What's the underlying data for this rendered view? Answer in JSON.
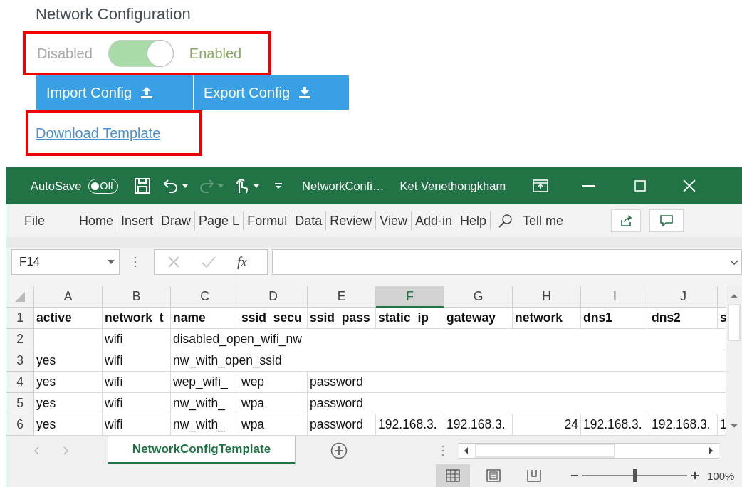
{
  "page": {
    "title": "Network Configuration",
    "toggle": {
      "off_label": "Disabled",
      "on_label": "Enabled",
      "on": true,
      "highlighted": true
    },
    "buttons": [
      {
        "label": "Import Config",
        "kind": "upload"
      },
      {
        "label": "Export Config",
        "kind": "download"
      }
    ],
    "link": {
      "label": "Download Template",
      "highlighted": true
    }
  },
  "excel": {
    "title_bar": {
      "autosave_label": "AutoSave",
      "autosave_state": "Off",
      "autosave_on": false,
      "file_name": "NetworkConfi…",
      "user": "Ket Venethongkham"
    },
    "ribbon_tabs": [
      "File",
      "Home",
      "Insert",
      "Draw",
      "Page L",
      "Formul",
      "Data",
      "Review",
      "View",
      "Add-in",
      "Help"
    ],
    "tell_me": "Tell me",
    "name_box": "F14",
    "fx": "fx",
    "columns": [
      {
        "label": "A",
        "selected": false
      },
      {
        "label": "B",
        "selected": false
      },
      {
        "label": "C",
        "selected": false
      },
      {
        "label": "D",
        "selected": false
      },
      {
        "label": "E",
        "selected": false
      },
      {
        "label": "F",
        "selected": true
      },
      {
        "label": "G",
        "selected": false
      },
      {
        "label": "H",
        "selected": false
      },
      {
        "label": "I",
        "selected": false
      },
      {
        "label": "J",
        "selected": false
      }
    ],
    "rows": [
      {
        "number": "1",
        "kind": "header",
        "cells": [
          {
            "kind": "text",
            "text": "active"
          },
          {
            "kind": "text",
            "text": "network_t"
          },
          {
            "kind": "text",
            "text": "name"
          },
          {
            "kind": "text",
            "text": "ssid_secu"
          },
          {
            "kind": "text",
            "text": "ssid_pass"
          },
          {
            "kind": "text",
            "text": "static_ip"
          },
          {
            "kind": "text",
            "text": "gateway"
          },
          {
            "kind": "text",
            "text": "network_"
          },
          {
            "kind": "text",
            "text": "dns1"
          },
          {
            "kind": "text",
            "text": "dns2"
          },
          {
            "kind": "text",
            "text": "s"
          }
        ]
      },
      {
        "number": "2",
        "kind": "data",
        "cells": [
          {
            "kind": "empty"
          },
          {
            "kind": "text",
            "text": "wifi"
          },
          {
            "kind": "text",
            "text": "disabled_open_wifi_nw"
          },
          {
            "kind": "empty"
          },
          {
            "kind": "empty"
          },
          {
            "kind": "empty"
          },
          {
            "kind": "empty"
          },
          {
            "kind": "empty"
          },
          {
            "kind": "empty"
          },
          {
            "kind": "empty"
          },
          {
            "kind": "empty"
          }
        ]
      },
      {
        "number": "3",
        "kind": "data",
        "cells": [
          {
            "kind": "text",
            "text": "yes"
          },
          {
            "kind": "text",
            "text": "wifi"
          },
          {
            "kind": "text",
            "text": "nw_with_open_ssid"
          },
          {
            "kind": "empty"
          },
          {
            "kind": "empty"
          },
          {
            "kind": "empty"
          },
          {
            "kind": "empty"
          },
          {
            "kind": "empty"
          },
          {
            "kind": "empty"
          },
          {
            "kind": "empty"
          },
          {
            "kind": "empty"
          }
        ]
      },
      {
        "number": "4",
        "kind": "data",
        "cells": [
          {
            "kind": "text",
            "text": "yes"
          },
          {
            "kind": "text",
            "text": "wifi"
          },
          {
            "kind": "text",
            "text": "wep_wifi_"
          },
          {
            "kind": "text",
            "text": "wep"
          },
          {
            "kind": "text",
            "text": "password"
          },
          {
            "kind": "empty"
          },
          {
            "kind": "empty"
          },
          {
            "kind": "empty"
          },
          {
            "kind": "empty"
          },
          {
            "kind": "empty"
          },
          {
            "kind": "empty"
          }
        ]
      },
      {
        "number": "5",
        "kind": "data",
        "cells": [
          {
            "kind": "text",
            "text": "yes"
          },
          {
            "kind": "text",
            "text": "wifi"
          },
          {
            "kind": "text",
            "text": "nw_with_"
          },
          {
            "kind": "text",
            "text": "wpa"
          },
          {
            "kind": "text",
            "text": "password"
          },
          {
            "kind": "empty"
          },
          {
            "kind": "empty"
          },
          {
            "kind": "empty"
          },
          {
            "kind": "empty"
          },
          {
            "kind": "empty"
          },
          {
            "kind": "empty"
          }
        ]
      },
      {
        "number": "6",
        "kind": "data",
        "cells": [
          {
            "kind": "text",
            "text": "yes"
          },
          {
            "kind": "text",
            "text": "wifi"
          },
          {
            "kind": "text",
            "text": "nw_with_"
          },
          {
            "kind": "text",
            "text": "wpa"
          },
          {
            "kind": "text",
            "text": "password"
          },
          {
            "kind": "text",
            "text": "192.168.3."
          },
          {
            "kind": "text",
            "text": "192.168.3."
          },
          {
            "kind": "number",
            "text": "24"
          },
          {
            "kind": "text",
            "text": "192.168.3."
          },
          {
            "kind": "text",
            "text": "192.168.3."
          },
          {
            "kind": "text",
            "text": "1"
          }
        ]
      }
    ],
    "sheet_tabs": [
      {
        "label": "NetworkConfigTemplate",
        "selected": true
      }
    ],
    "view_modes": [
      {
        "kind": "normal",
        "selected": true
      },
      {
        "kind": "page_layout",
        "selected": false
      },
      {
        "kind": "page_break",
        "selected": false
      }
    ],
    "zoom": {
      "level": 0.5,
      "reading": "100%"
    }
  }
}
